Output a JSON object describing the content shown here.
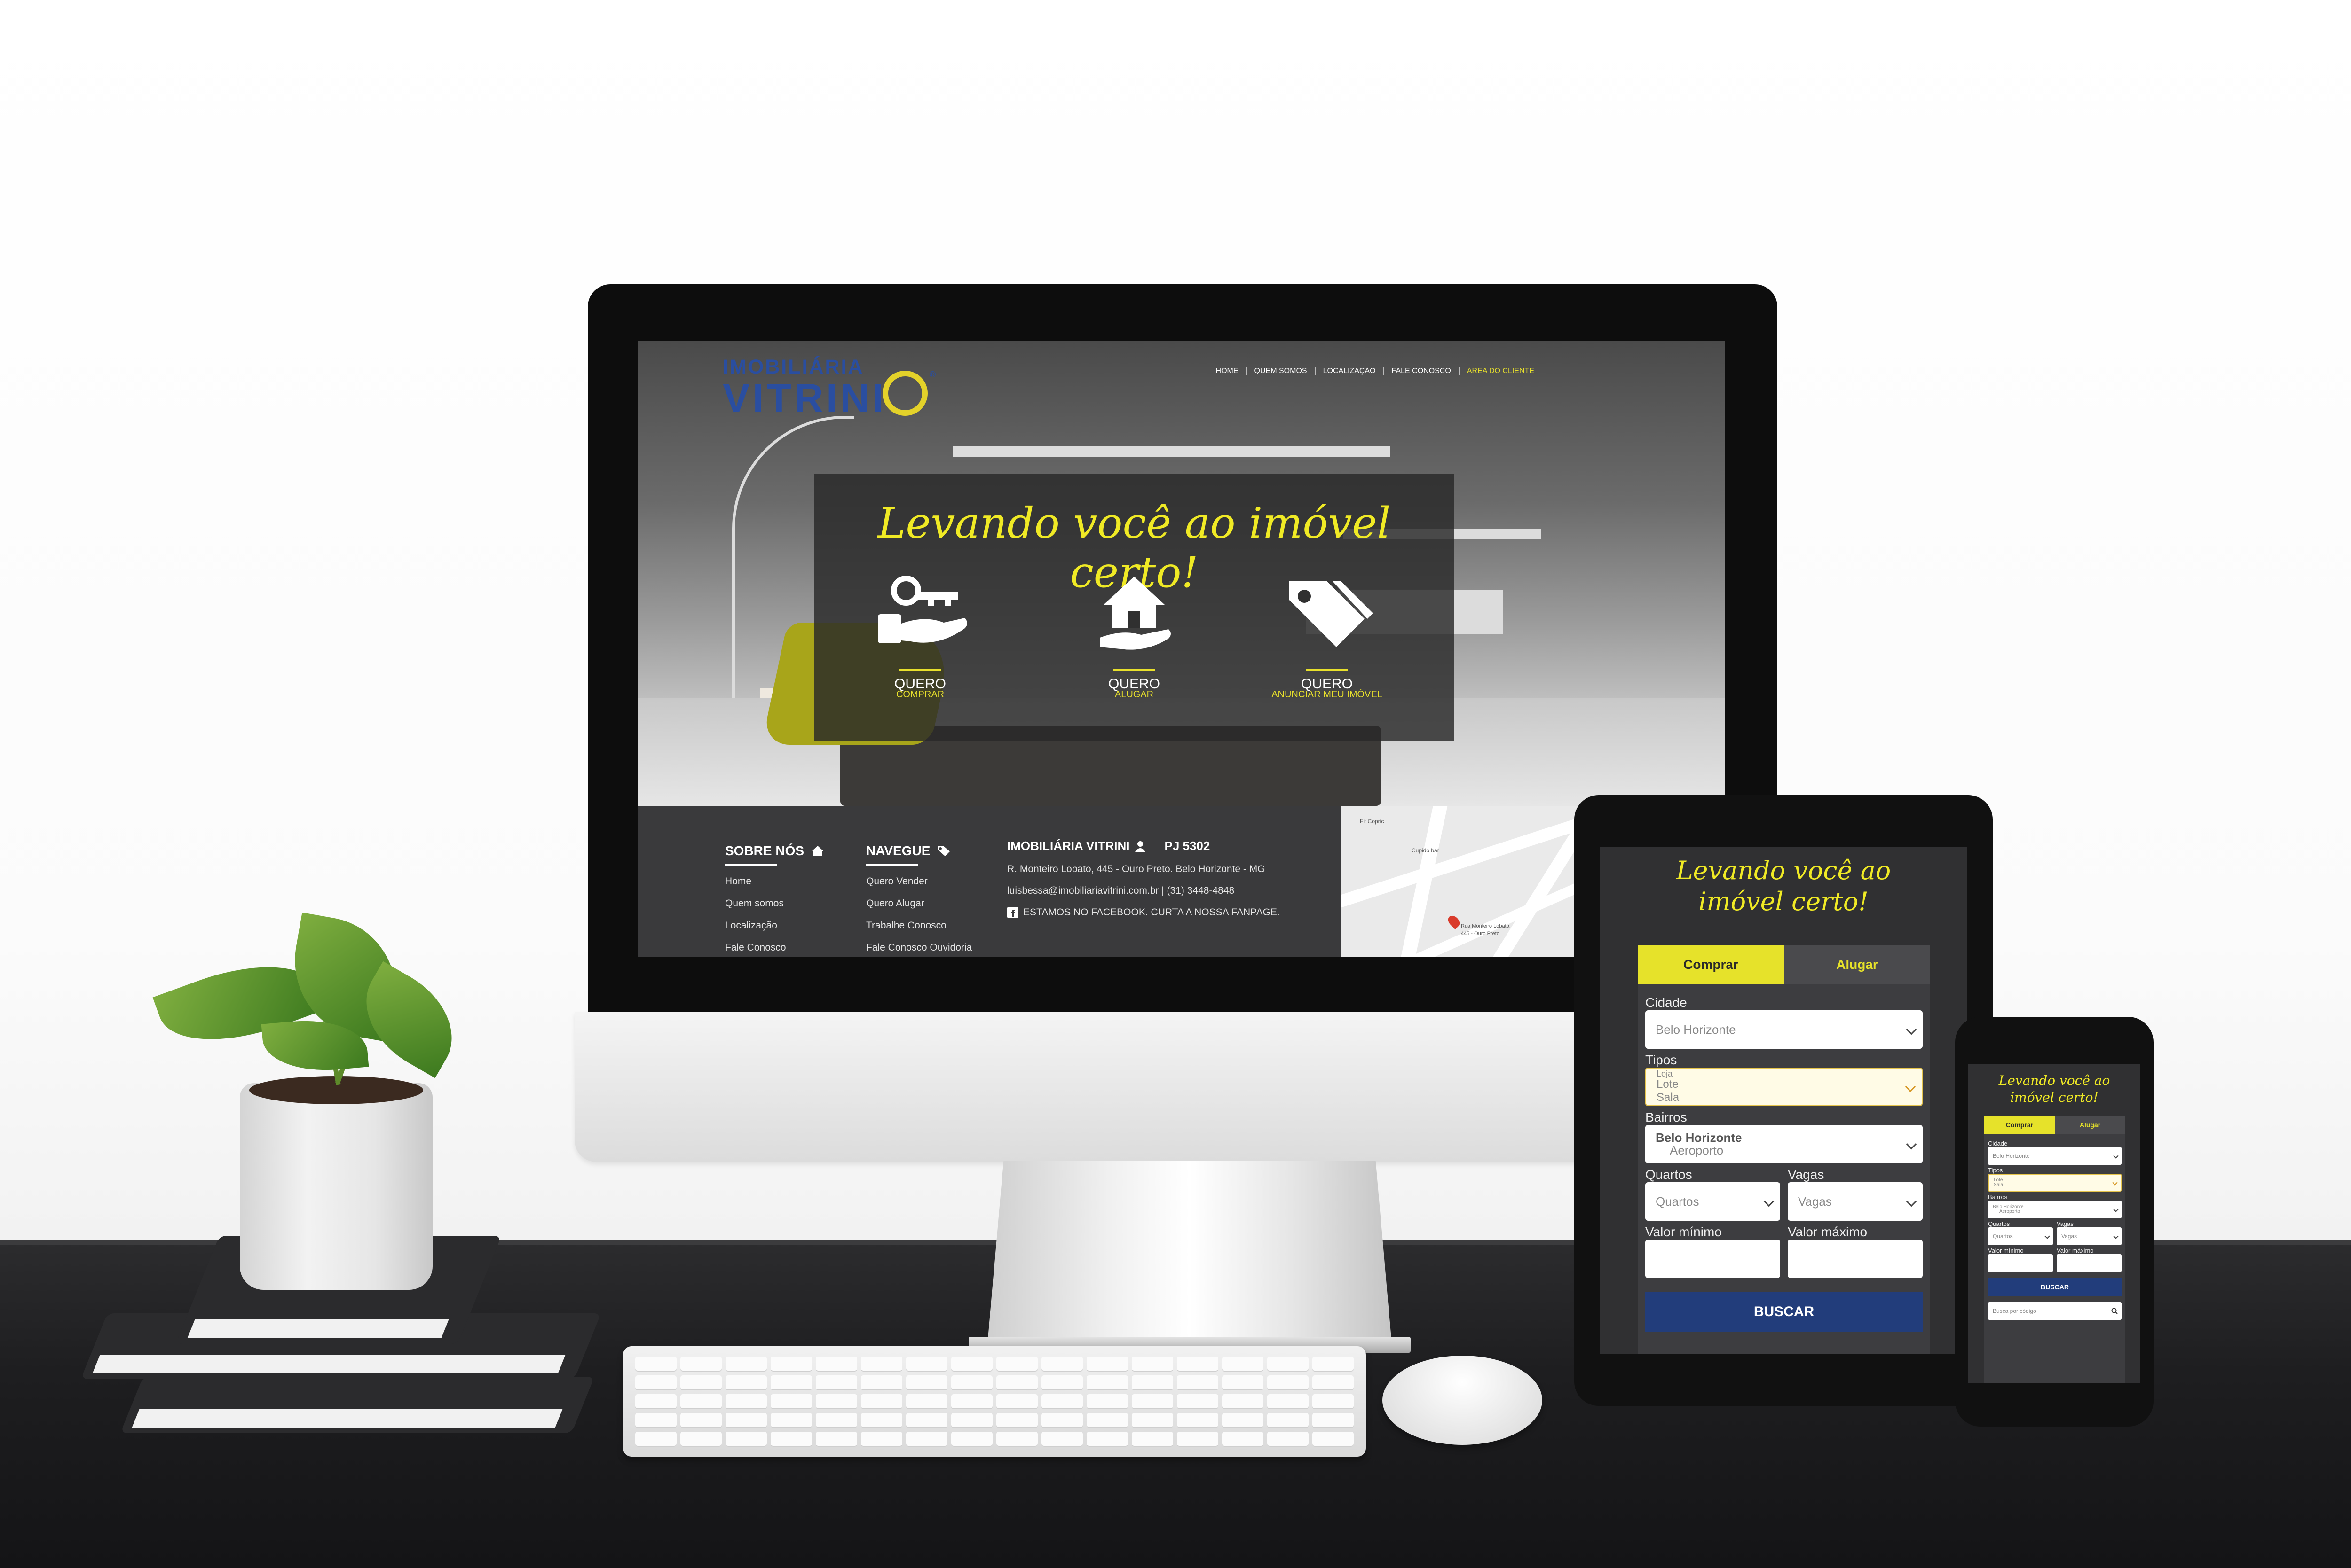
{
  "desktop": {
    "logo": {
      "line1": "IMOBILIÁRIA",
      "line2": "VITRINI",
      "registered": "®"
    },
    "nav": [
      {
        "label": "HOME"
      },
      {
        "label": "QUEM SOMOS"
      },
      {
        "label": "LOCALIZAÇÃO"
      },
      {
        "label": "FALE CONOSCO"
      },
      {
        "label": "ÁREA DO CLIENTE"
      }
    ],
    "hero": {
      "headline": "Levando você ao imóvel certo!",
      "actions": [
        {
          "line1": "QUERO",
          "line2": "COMPRAR",
          "icon": "keys-hand-icon"
        },
        {
          "line1": "QUERO",
          "line2": "ALUGAR",
          "icon": "house-hand-icon"
        },
        {
          "line1": "QUERO",
          "line2": "ANUNCIAR MEU IMÓVEL",
          "icon": "price-tag-icon"
        }
      ]
    },
    "footer": {
      "sobre": {
        "title": "SOBRE NÓS",
        "links": [
          "Home",
          "Quem somos",
          "Localização",
          "Fale Conosco"
        ]
      },
      "navegue": {
        "title": "NAVEGUE",
        "links": [
          "Quero Vender",
          "Quero Alugar",
          "Trabalhe Conosco",
          "Fale Conosco Ouvidoria"
        ]
      },
      "info": {
        "name": "IMOBILIÁRIA VITRINI",
        "pj": "PJ 5302",
        "address": "R. Monteiro Lobato, 445 - Ouro Preto. Belo Horizonte - MG",
        "contact": "luisbessa@imobiliariavitrini.com.br | (31) 3448-4848",
        "facebook": "ESTAMOS NO FACEBOOK. CURTA A NOSSA FANPAGE."
      },
      "map": {
        "label1": "Rua Monteiro Lobato,",
        "label2": "445 - Ouro Preto",
        "place1": "Fit Copric",
        "place2": "Cupido bar"
      }
    }
  },
  "tablet": {
    "headline_1": "Levando você ao",
    "headline_2": "imóvel certo!",
    "tabs": {
      "comprar": "Comprar",
      "alugar": "Alugar"
    },
    "cidade": {
      "label": "Cidade",
      "value": "Belo Horizonte"
    },
    "tipos": {
      "label": "Tipos",
      "options": [
        "Loja",
        "Lote",
        "Sala"
      ]
    },
    "bairros": {
      "label": "Bairros",
      "options": [
        "Belo Horizonte",
        "Aeroporto"
      ]
    },
    "quartos": {
      "label": "Quartos",
      "value": "Quartos"
    },
    "vagas": {
      "label": "Vagas",
      "value": "Vagas"
    },
    "valor_min": {
      "label": "Valor mínimo"
    },
    "valor_max": {
      "label": "Valor máximo"
    },
    "buscar": "BUSCAR"
  },
  "phone": {
    "headline_1": "Levando você ao",
    "headline_2": "imóvel certo!",
    "tabs": {
      "comprar": "Comprar",
      "alugar": "Alugar"
    },
    "cidade": {
      "label": "Cidade",
      "value": "Belo Horizonte"
    },
    "tipos": {
      "label": "Tipos",
      "options": [
        "Lote",
        "Sala"
      ]
    },
    "bairros": {
      "label": "Bairros",
      "options": [
        "Belo Horizonte",
        "Aeroporto"
      ]
    },
    "quartos": {
      "label": "Quartos",
      "value": "Quartos"
    },
    "vagas": {
      "label": "Vagas",
      "value": "Vagas"
    },
    "valor_min": {
      "label": "Valor mínimo"
    },
    "valor_max": {
      "label": "Valor máximo"
    },
    "buscar": "BUSCAR",
    "codigo_placeholder": "Busca por código"
  },
  "colors": {
    "accent_yellow": "#e8e02c",
    "brand_blue": "#2a4ea0",
    "button_blue": "#223d7b",
    "panel_dark": "#3d3d40"
  }
}
